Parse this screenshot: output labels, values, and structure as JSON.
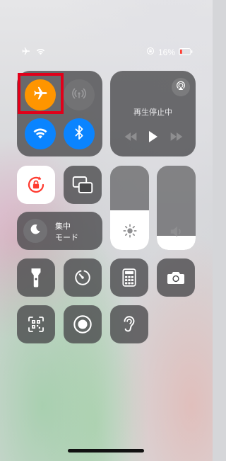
{
  "status_bar": {
    "battery_percent": "16%",
    "icons": [
      "airplane-icon",
      "wifi-icon",
      "orientation-lock-icon",
      "battery-icon"
    ]
  },
  "connectivity": {
    "airplane_mode": {
      "icon": "airplane-icon",
      "state": "on",
      "color": "#ff9500"
    },
    "cellular_data": {
      "icon": "cellular-antenna-icon",
      "state": "off"
    },
    "wifi": {
      "icon": "wifi-icon",
      "state": "on",
      "color": "#0a84ff"
    },
    "bluetooth": {
      "icon": "bluetooth-icon",
      "state": "on",
      "color": "#0a84ff"
    }
  },
  "now_playing": {
    "status_text": "再生停止中",
    "icons": [
      "airplay-audio-icon",
      "rewind-icon",
      "play-icon",
      "fast-forward-icon"
    ]
  },
  "orientation_lock": {
    "icon": "orientation-lock-icon",
    "state": "on",
    "color": "#ff3b30"
  },
  "screen_mirroring": {
    "icon": "screen-mirroring-icon"
  },
  "brightness": {
    "icon": "sun-icon",
    "level": 0.47
  },
  "volume": {
    "icon": "speaker-icon",
    "level": 0.17
  },
  "focus": {
    "icon": "moon-icon",
    "label_line1": "集中",
    "label_line2": "モード"
  },
  "controls_row1": [
    "flashlight-icon",
    "timer-icon",
    "calculator-icon",
    "camera-icon"
  ],
  "controls_row2": [
    "qr-code-scanner-icon",
    "screen-recording-icon",
    "hearing-icon"
  ],
  "annotation": {
    "color": "#e1001a"
  }
}
